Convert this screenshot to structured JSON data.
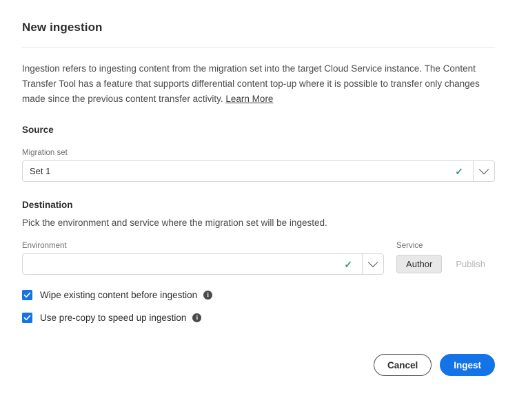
{
  "dialog": {
    "title": "New ingestion",
    "intro": "Ingestion refers to ingesting content from the migration set into the target Cloud Service instance. The Content Transfer Tool has a feature that supports differential content top-up where it is possible to transfer only changes made since the previous content transfer activity. ",
    "learn_more_label": "Learn More"
  },
  "source": {
    "heading": "Source",
    "migration_set": {
      "label": "Migration set",
      "value": "Set 1",
      "placeholder": "",
      "valid_icon": "check-icon",
      "chevron_icon": "chevron-down-icon"
    }
  },
  "destination": {
    "heading": "Destination",
    "description": "Pick the environment and service where the migration set will be ingested.",
    "environment": {
      "label": "Environment",
      "value": "",
      "placeholder": "",
      "valid_icon": "check-icon",
      "chevron_icon": "chevron-down-icon"
    },
    "service": {
      "label": "Service",
      "options": [
        "Author",
        "Publish"
      ],
      "selected": "Author"
    }
  },
  "options": [
    {
      "label": "Wipe existing content before ingestion",
      "checked": true,
      "info_icon": "info-icon"
    },
    {
      "label": "Use pre-copy to speed up ingestion",
      "checked": true,
      "info_icon": "info-icon"
    }
  ],
  "footer": {
    "cancel_label": "Cancel",
    "ingest_label": "Ingest"
  },
  "colors": {
    "accent_blue": "#1473E6",
    "valid_green": "#2D9D78",
    "border_gray": "#D6D6D6",
    "text_primary": "#2C2C2C",
    "text_secondary": "#6E6E6E"
  }
}
